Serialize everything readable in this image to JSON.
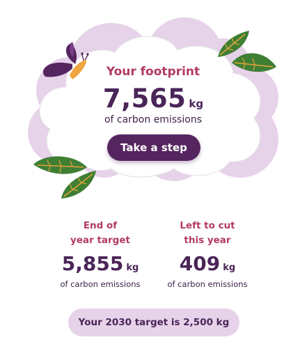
{
  "footprint": {
    "title": "Your footprint",
    "value": "7,565",
    "unit": "kg",
    "description": "of carbon emissions",
    "button_label": "Take a step"
  },
  "stats": [
    {
      "label_line1": "End of",
      "label_line2": "year target",
      "value": "5,855",
      "unit": "kg",
      "description": "of carbon emissions"
    },
    {
      "label_line1": "Left to cut",
      "label_line2": "this year",
      "value": "409",
      "unit": "kg",
      "description": "of carbon emissions"
    }
  ],
  "target_banner": "Your 2030 target is 2,500 kg",
  "colors": {
    "accent_pink": "#b23a66",
    "deep_purple": "#4a2558",
    "button_purple": "#55255f",
    "cloud_lilac": "#e6d2e9",
    "leaf_green": "#3f7f34",
    "leaf_vein": "#e3a23a",
    "butterfly_body": "#f0a640"
  },
  "illustration": {
    "back_cloud": "lilac-cloud-illustration",
    "front_cloud": "white-cloud-illustration",
    "decorations": [
      "butterfly-icon",
      "leaf-icon"
    ]
  }
}
